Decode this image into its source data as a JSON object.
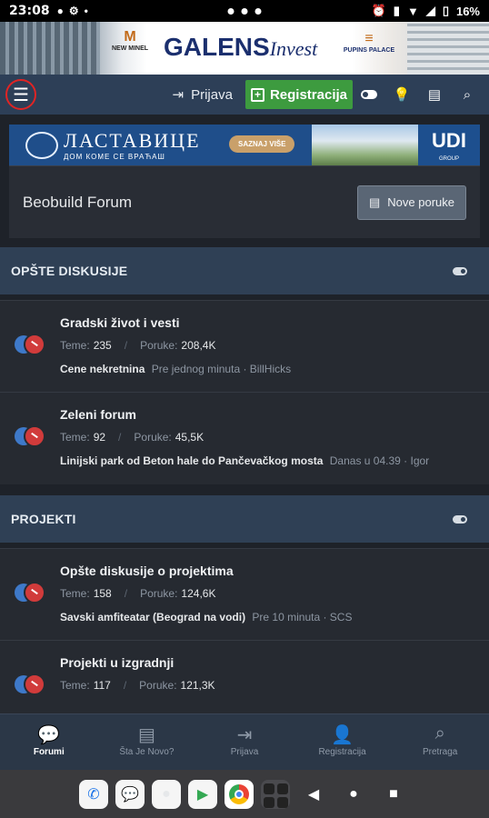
{
  "status_bar": {
    "time": "23:08",
    "battery": "16%"
  },
  "top_ad": {
    "brand_left": "NEW MINEL",
    "brand_main": "GALENS",
    "brand_main_suffix": "Invest",
    "brand_right": "PUPINS PALACE"
  },
  "navbar": {
    "login_label": "Prijava",
    "register_label": "Registracija"
  },
  "mid_ad": {
    "title": "ЛАСТАВИЦЕ",
    "subtitle": "ДОМ КОМЕ СЕ ВРАЋАШ",
    "cta": "SAZNAJ VIŠE",
    "brand": "UDI",
    "brand_sub": "GROUP"
  },
  "forum_header": {
    "title": "Beobuild Forum",
    "new_posts_label": "Nove poruke"
  },
  "sections": [
    {
      "name": "OPŠTE DISKUSIJE",
      "forums": [
        {
          "title": "Gradski život i vesti",
          "threads_label": "Teme:",
          "threads": "235",
          "posts_label": "Poruke:",
          "posts": "208,4K",
          "last_thread": "Cene nekretnina",
          "last_meta": "Pre jednog minuta · BillHicks"
        },
        {
          "title": "Zeleni forum",
          "threads_label": "Teme:",
          "threads": "92",
          "posts_label": "Poruke:",
          "posts": "45,5K",
          "last_thread": "Linijski park od Beton hale do Pančevačkog mosta",
          "last_meta": "Danas u 04.39 · Igor"
        }
      ]
    },
    {
      "name": "PROJEKTI",
      "forums": [
        {
          "title": "Opšte diskusije o projektima",
          "threads_label": "Teme:",
          "threads": "158",
          "posts_label": "Poruke:",
          "posts": "124,6K",
          "last_thread": "Savski amfiteatar (Beograd na vodi)",
          "last_meta": "Pre 10 minuta · SCS"
        },
        {
          "title": "Projekti u izgradnji",
          "threads_label": "Teme:",
          "threads": "117",
          "posts_label": "Poruke:",
          "posts": "121,3K",
          "last_thread": "",
          "last_meta": ""
        }
      ]
    }
  ],
  "tabbar": {
    "tabs": [
      {
        "label": "Forumi",
        "icon": "forums-icon"
      },
      {
        "label": "Šta Je Novo?",
        "icon": "document-icon"
      },
      {
        "label": "Prijava",
        "icon": "login-icon"
      },
      {
        "label": "Registracija",
        "icon": "add-user-icon"
      },
      {
        "label": "Pretraga",
        "icon": "search-icon"
      }
    ]
  }
}
